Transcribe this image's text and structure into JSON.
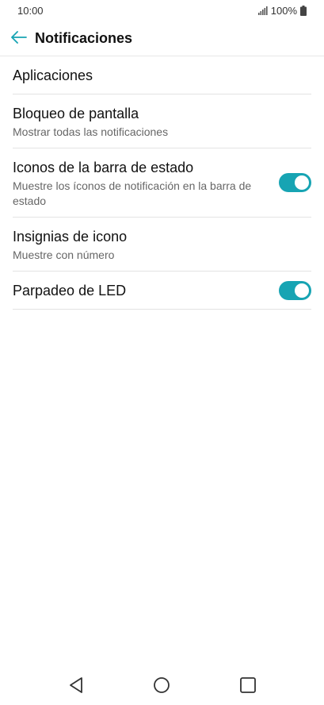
{
  "status_bar": {
    "time": "10:00",
    "battery": "100%",
    "icons": [
      "signal-icon",
      "battery-icon"
    ]
  },
  "app_bar": {
    "title": "Notificaciones",
    "back_icon": "back-arrow-icon"
  },
  "colors": {
    "accent": "#17a4b3",
    "divider": "#e3e3e3",
    "subtitle": "#666666"
  },
  "settings": {
    "items": [
      {
        "title": "Aplicaciones"
      },
      {
        "title": "Bloqueo de pantalla",
        "subtitle": "Mostrar todas las notificaciones"
      },
      {
        "title": "Iconos de la barra de estado",
        "subtitle": "Muestre los íconos de notificación en la barra de estado",
        "toggle_on": true
      },
      {
        "title": "Insignias de icono",
        "subtitle": "Muestre con número"
      },
      {
        "title": "Parpadeo de LED",
        "toggle_on": true
      }
    ]
  },
  "nav_bar": {
    "icons": [
      "back-triangle-icon",
      "home-circle-icon",
      "recents-square-icon"
    ]
  }
}
